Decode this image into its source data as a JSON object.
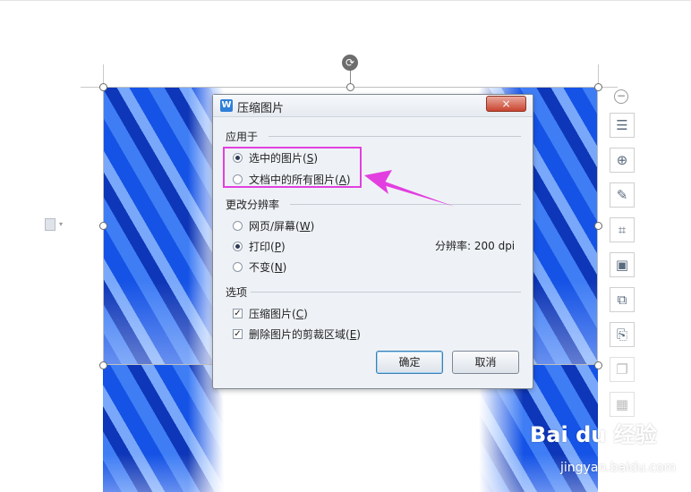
{
  "dialog": {
    "title": "压缩图片",
    "app_icon": "W",
    "close_label": "×",
    "apply_section": "应用于",
    "apply_options": [
      {
        "text": "选中的图片(",
        "key": "S",
        "tail": ")",
        "selected": true
      },
      {
        "text": "文档中的所有图片(",
        "key": "A",
        "tail": ")",
        "selected": false
      }
    ],
    "resolution_section": "更改分辨率",
    "resolution_options": [
      {
        "text": "网页/屏幕(",
        "key": "W",
        "tail": ")",
        "selected": false
      },
      {
        "text": "打印(",
        "key": "P",
        "tail": ")",
        "selected": true
      },
      {
        "text": "不变(",
        "key": "N",
        "tail": ")",
        "selected": false
      }
    ],
    "resolution_value": "分辨率:  200 dpi",
    "options_section": "选项",
    "checkbox_options": [
      {
        "text": "压缩图片(",
        "key": "C",
        "tail": ")",
        "checked": true
      },
      {
        "text": "删除图片的剪裁区域(",
        "key": "E",
        "tail": ")",
        "checked": true
      }
    ],
    "ok_label": "确定",
    "cancel_label": "取消"
  },
  "toolbar": {
    "icons": [
      "wrap-text-icon",
      "zoom-in-icon",
      "edit-icon",
      "crop-icon",
      "image-adjust-icon",
      "replace-image-icon",
      "save-image-icon",
      "copy-image-icon",
      "layers-icon"
    ],
    "minus_label": "−"
  },
  "annotation": {
    "highlight_color": "#e33fe0"
  },
  "watermark": {
    "logo": "Bai du 经验",
    "url": "jingyan.baidu.com"
  },
  "colors": {
    "image_blue": "#1553e6",
    "dialog_bg": "#eef2f6"
  }
}
